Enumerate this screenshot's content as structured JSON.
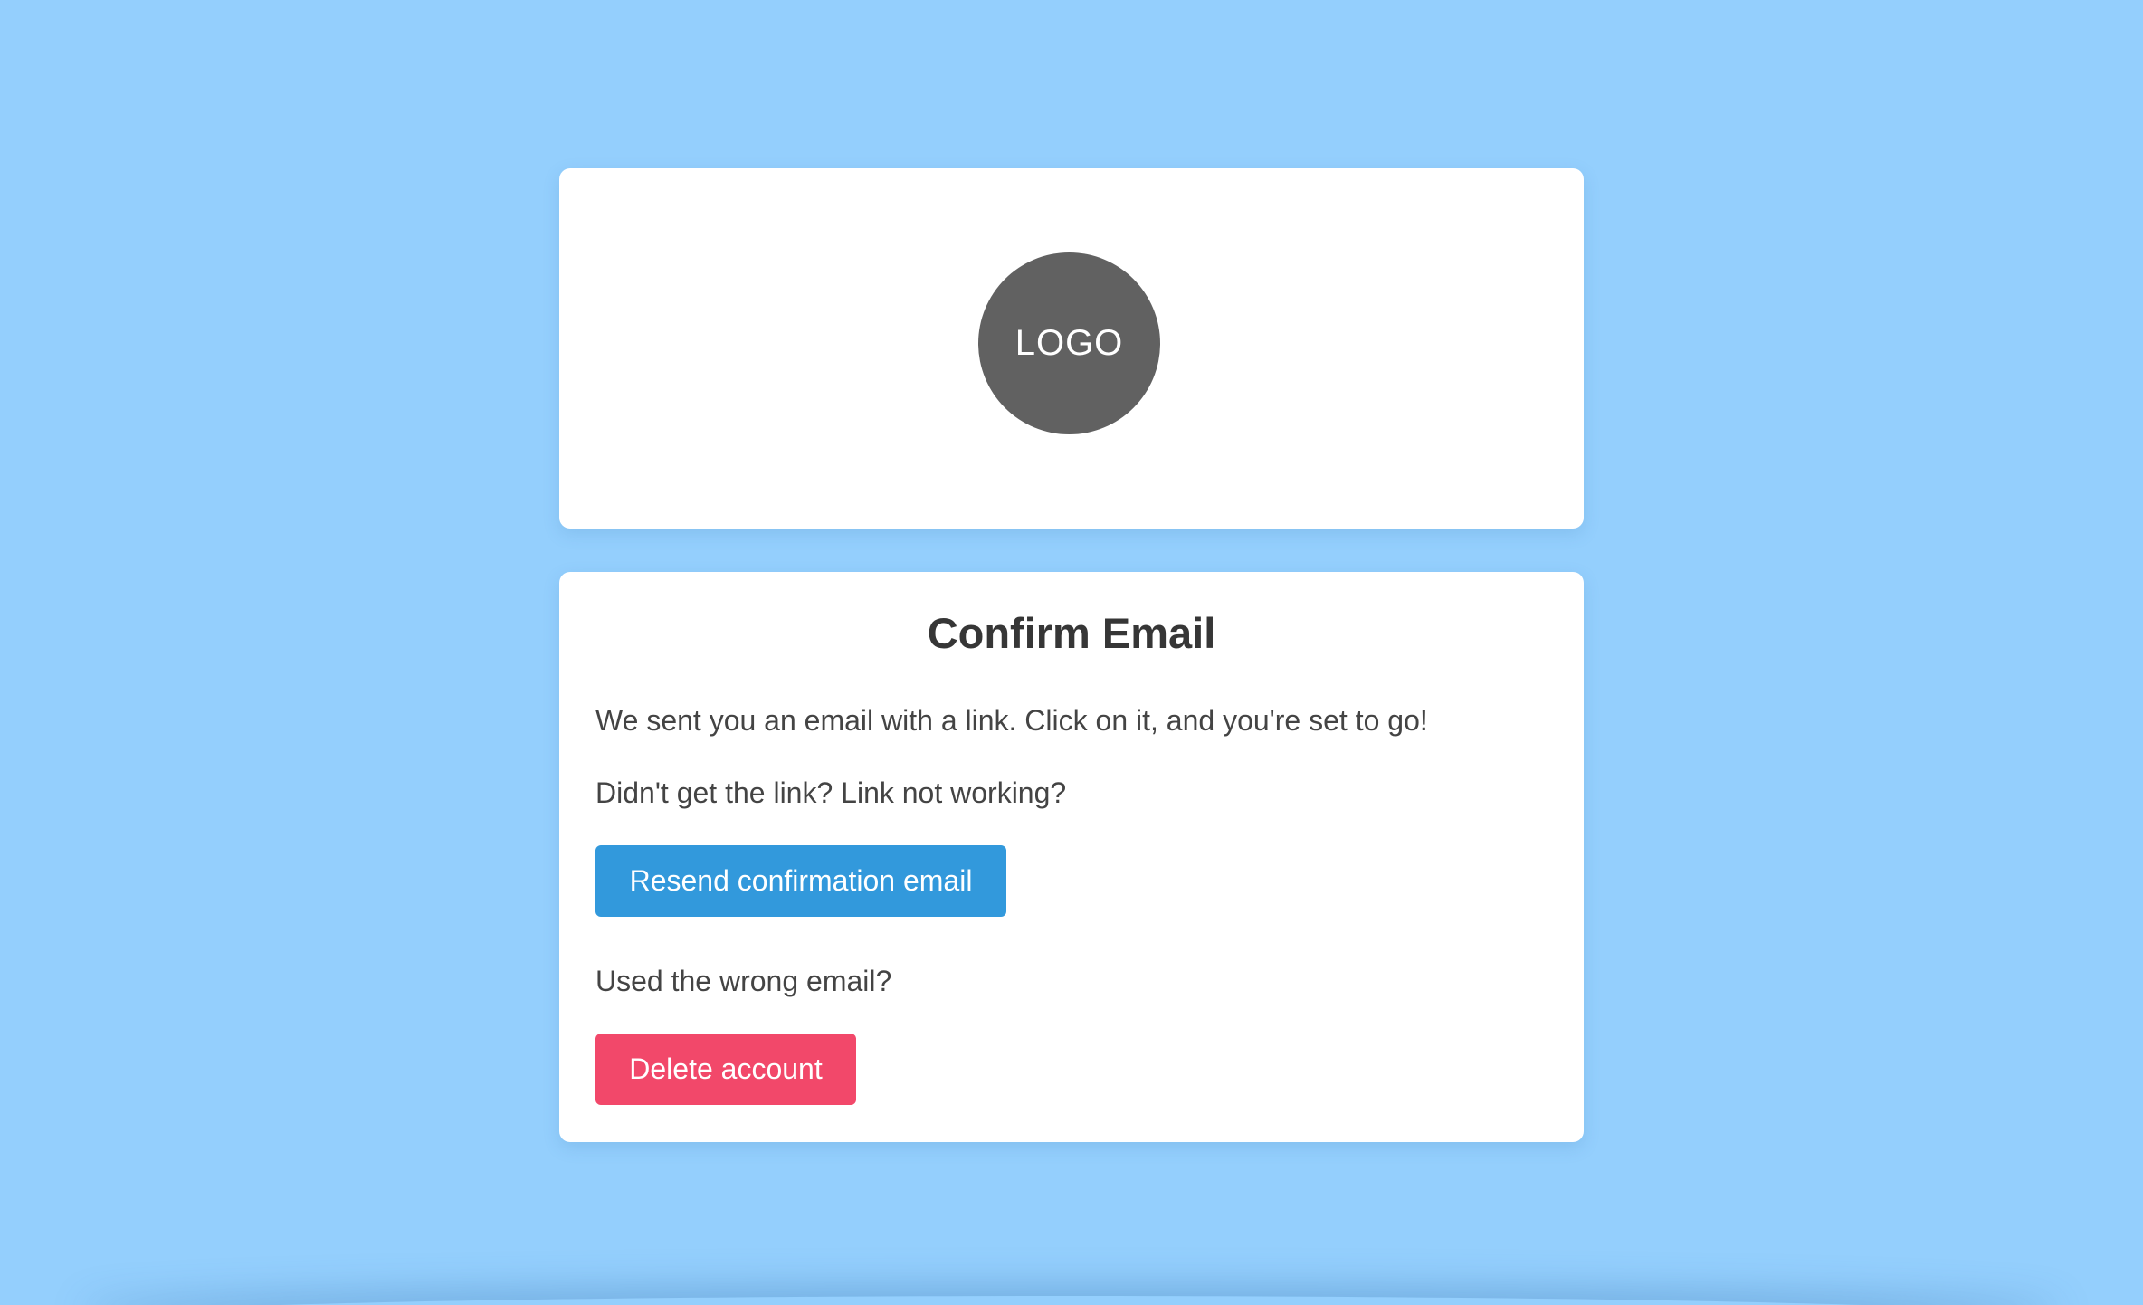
{
  "logo": {
    "text": "LOGO"
  },
  "confirm": {
    "title": "Confirm Email",
    "message": "We sent you an email with a link. Click on it, and you're set to go!",
    "resend_prompt": "Didn't get the link? Link not working?",
    "resend_button": "Resend confirmation email",
    "wrong_email_prompt": "Used the wrong email?",
    "delete_button": "Delete account"
  },
  "colors": {
    "background": "#94cffd",
    "logo_circle": "#616161",
    "resend_button": "#3299dc",
    "delete_button": "#f2486a"
  }
}
